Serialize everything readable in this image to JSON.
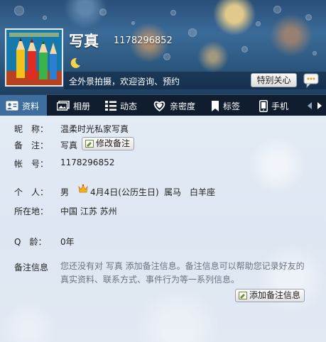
{
  "profile": {
    "nickname": "写真",
    "qq_number": "1178296852",
    "signature": "全外景拍摄，欢迎咨询、预约",
    "special_care_label": "特别关心"
  },
  "tabs": [
    {
      "label": "资料",
      "icon": "profile-card-icon"
    },
    {
      "label": "相册",
      "icon": "album-icon"
    },
    {
      "label": "动态",
      "icon": "feed-icon"
    },
    {
      "label": "亲密度",
      "icon": "heart-icon"
    },
    {
      "label": "标签",
      "icon": "bookmark-icon"
    },
    {
      "label": "手机",
      "icon": "phone-icon"
    }
  ],
  "details": {
    "nickname_label": "昵　称：",
    "nickname_value": "温柔时光私家写真",
    "remark_label": "备　注：",
    "remark_value": "写真",
    "edit_remark_label": "修改备注",
    "account_label": "帐　号：",
    "account_value": "1178296852",
    "personal_label": "个　人：",
    "gender": "男",
    "birthday": "4月4日(公历生日)",
    "zodiac": "属马",
    "constellation": "白羊座",
    "location_label": "所在地：",
    "location_value": "中国 江苏 苏州",
    "qage_label": "Q　龄：",
    "qage_value": "0年",
    "remark_info_label": "备注信息",
    "remark_info_hint": "您还没有对 写真 添加备注信息。备注信息可以帮助您记录好友的真实资料、联系方式、事件行为等一系列信息。",
    "add_remark_label": "添加备注信息"
  },
  "colors": {
    "tab_bar": "#0f1d2e",
    "tab_active": "#3d6e9e",
    "content_bg": "#e3ebf5"
  }
}
